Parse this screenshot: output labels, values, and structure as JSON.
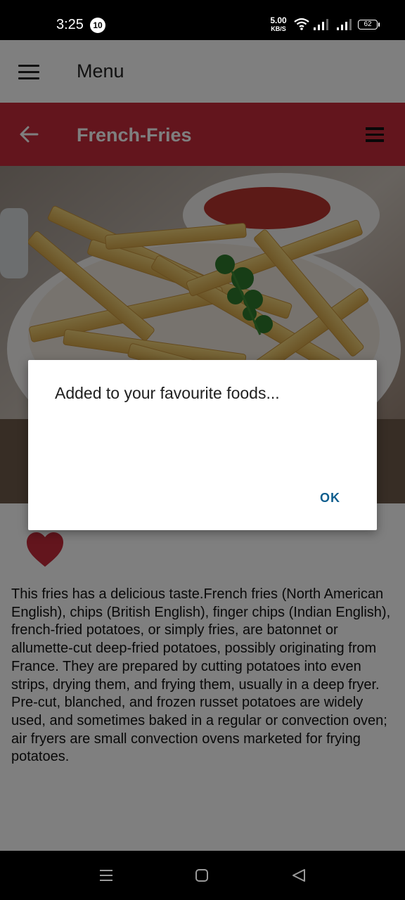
{
  "status_bar": {
    "time": "3:25",
    "notification_count": "10",
    "net_speed_value": "5.00",
    "net_speed_unit": "KB/S",
    "battery": "62"
  },
  "top_bar": {
    "title": "Menu"
  },
  "food_header": {
    "title": "French-Fries",
    "color": "#c62a3b"
  },
  "food": {
    "image_subject": "french fries with parsley and ketchup",
    "favourite": true,
    "description": "This fries has a delicious taste.French fries (North American English), chips (British English), finger chips (Indian English), french-fried potatoes, or simply fries, are batonnet or allumette-cut deep-fried potatoes, possibly originating from France. They are prepared by cutting potatoes into even strips, drying them, and frying them, usually in a deep fryer. Pre-cut, blanched, and frozen russet potatoes are widely used, and sometimes baked in a regular or convection oven; air fryers are small convection ovens marketed for frying potatoes."
  },
  "dialog": {
    "message": "Added to your favourite foods...",
    "ok_label": "OK"
  },
  "icons": {
    "hamburger": "hamburger-icon",
    "back": "back-arrow-icon",
    "overflow": "overflow-menu-icon",
    "heart": "heart-icon"
  }
}
